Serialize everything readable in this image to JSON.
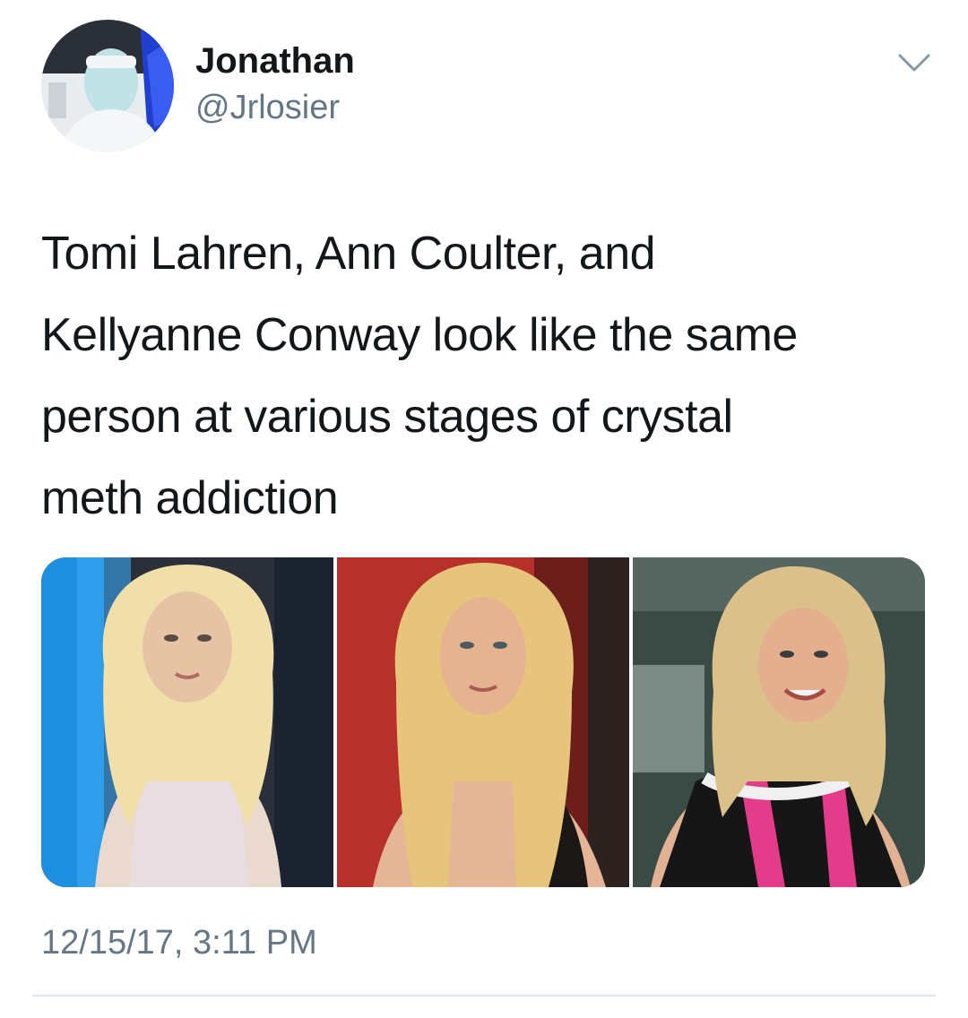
{
  "author": {
    "display_name": "Jonathan",
    "handle": "@Jrlosier"
  },
  "tweet": {
    "lines": [
      "Tomi Lahren, Ann Coulter, and",
      "Kellyanne Conway look like the same",
      "person at various stages of crystal",
      "meth addiction"
    ],
    "timestamp": "12/15/17, 3:11 PM"
  },
  "media": {
    "photos": [
      {
        "name": "photo-1-blonde-woman-tv-studio"
      },
      {
        "name": "photo-2-blonde-woman-red-background"
      },
      {
        "name": "photo-3-blonde-woman-smiling"
      }
    ]
  },
  "icons": {
    "menu": "chevron-down-icon"
  },
  "colors": {
    "text": "#14171a",
    "secondary": "#657786",
    "divider": "#e1e8ed"
  }
}
